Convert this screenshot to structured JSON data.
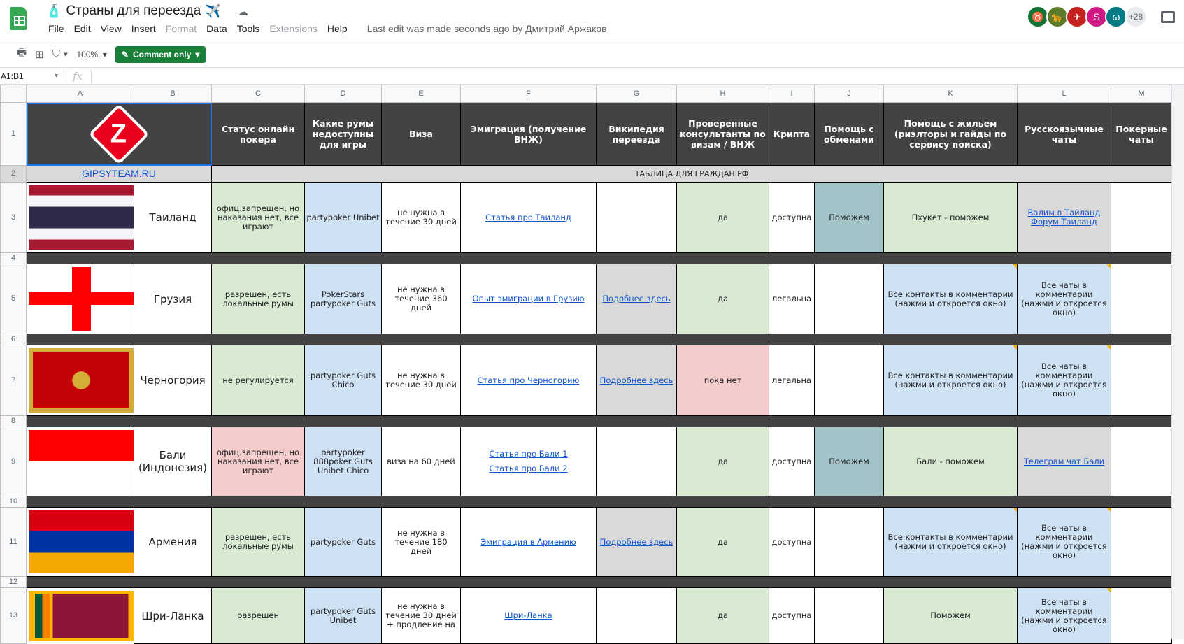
{
  "app": {
    "title": "Страны для переезда",
    "menu": [
      "File",
      "Edit",
      "View",
      "Insert",
      "Format",
      "Data",
      "Tools",
      "Extensions",
      "Help"
    ],
    "disabled_menu": [
      "Format",
      "Extensions"
    ],
    "last_edit": "Last edit was made seconds ago by Дмитрий Аржаков",
    "avatars_more": "+28"
  },
  "toolbar": {
    "zoom": "100%",
    "comment_only": "Comment only"
  },
  "formula": {
    "name_box": "A1:B1",
    "fx": "fx"
  },
  "columns": [
    "A",
    "B",
    "C",
    "D",
    "E",
    "F",
    "G",
    "H",
    "I",
    "J",
    "K",
    "L",
    "M"
  ],
  "row_numbers": [
    "1",
    "2",
    "3",
    "4",
    "5",
    "6",
    "7",
    "8",
    "9",
    "10",
    "11",
    "12",
    "13"
  ],
  "headers": [
    "Статус онлайн покера",
    "Какие румы недоступны для игры",
    "Виза",
    "Эмиграция (получение ВНЖ)",
    "Википедия переезда",
    "Проверенные консультанты по визам / ВНЖ",
    "Крипта",
    "Помощь с обменами",
    "Помощь с жильем (риэлторы и гайды по сервису поиска)",
    "Русскоязычные чаты",
    "Покерные чаты"
  ],
  "site_link": "GIPSYTEAM.RU",
  "logo_text": "Z",
  "banner": "ТАБЛИЦА ДЛЯ ГРАЖДАН РФ",
  "colors": {
    "green": "#d9ead3",
    "blue": "#cfe2f3",
    "gray": "#d9d9d9",
    "teal": "#a2c4c9",
    "pink": "#f4cccc",
    "white": "#ffffff",
    "dark": "#434343"
  },
  "rows": [
    {
      "flag": "thailand",
      "name": "Таиланд",
      "cells": [
        {
          "text": "офиц.запрещен, но наказания нет, все играют",
          "bg": "green"
        },
        {
          "text": "partypoker Unibet",
          "bg": "blue"
        },
        {
          "text": "не нужна в течение 30 дней",
          "bg": "white"
        },
        {
          "links": [
            "Статья про Таиланд"
          ],
          "bg": "white"
        },
        {
          "text": "",
          "bg": "white"
        },
        {
          "text": "да",
          "bg": "green"
        },
        {
          "text": "доступна",
          "bg": "white",
          "narrow": true
        },
        {
          "text": "Поможем",
          "bg": "teal"
        },
        {
          "text": "Пхукет - поможем",
          "bg": "green"
        },
        {
          "links": [
            "Валим в Тайланд",
            "Форум Таиланд"
          ],
          "bg": "gray"
        },
        {
          "text": "",
          "bg": "white"
        }
      ]
    },
    {
      "flag": "georgia",
      "name": "Грузия",
      "cells": [
        {
          "text": "разрешен, есть локальные румы",
          "bg": "green"
        },
        {
          "text": "PokerStars partypoker Guts",
          "bg": "blue"
        },
        {
          "text": "не нужна в течение 360 дней",
          "bg": "white"
        },
        {
          "links": [
            "Опыт эмиграции в Грузию"
          ],
          "bg": "white"
        },
        {
          "links": [
            "Подобнее здесь"
          ],
          "bg": "gray"
        },
        {
          "text": "да",
          "bg": "green"
        },
        {
          "text": "легальна",
          "bg": "white",
          "narrow": true
        },
        {
          "text": "",
          "bg": "white"
        },
        {
          "text": "Все контакты в комментарии (нажми и откроется окно)",
          "bg": "blue",
          "comment": true
        },
        {
          "text": "Все чаты в комментарии (нажми и откроется окно)",
          "bg": "blue",
          "comment": true
        },
        {
          "text": "",
          "bg": "white"
        }
      ]
    },
    {
      "flag": "montenegro",
      "name": "Черногория",
      "cells": [
        {
          "text": "не регулируется",
          "bg": "green"
        },
        {
          "text": "partypoker Guts Chico",
          "bg": "blue"
        },
        {
          "text": "не нужна в течение 30 дней",
          "bg": "white"
        },
        {
          "links": [
            "Статья про Черногорию"
          ],
          "bg": "white"
        },
        {
          "links": [
            "Подробнее здесь"
          ],
          "bg": "gray"
        },
        {
          "text": "пока нет",
          "bg": "pink"
        },
        {
          "text": "легальна",
          "bg": "white",
          "narrow": true
        },
        {
          "text": "",
          "bg": "white"
        },
        {
          "text": "Все контакты в комментарии (нажми и откроется окно)",
          "bg": "blue",
          "comment": true
        },
        {
          "text": "Все чаты в комментарии (нажми и откроется окно)",
          "bg": "blue",
          "comment": true
        },
        {
          "text": "",
          "bg": "white"
        }
      ]
    },
    {
      "flag": "indonesia",
      "name": "Бали (Индонезия)",
      "cells": [
        {
          "text": "офиц.запрещен, но наказания нет, все играют",
          "bg": "pink"
        },
        {
          "text": "partypoker 888poker Guts Unibet Chico",
          "bg": "blue"
        },
        {
          "text": "виза на 60 дней",
          "bg": "white"
        },
        {
          "links": [
            "Статья про Бали 1",
            "Статья про Бали 2"
          ],
          "bg": "white"
        },
        {
          "text": "",
          "bg": "white"
        },
        {
          "text": "да",
          "bg": "green"
        },
        {
          "text": "доступна",
          "bg": "white",
          "narrow": true
        },
        {
          "text": "Поможем",
          "bg": "teal"
        },
        {
          "text": "Бали - поможем",
          "bg": "green"
        },
        {
          "links": [
            "Телеграм чат Бали"
          ],
          "bg": "gray"
        },
        {
          "text": "",
          "bg": "white"
        }
      ]
    },
    {
      "flag": "armenia",
      "name": "Армения",
      "cells": [
        {
          "text": "разрешен, есть локальные румы",
          "bg": "green"
        },
        {
          "text": "partypoker Guts",
          "bg": "blue"
        },
        {
          "text": "не нужна в течение 180 дней",
          "bg": "white"
        },
        {
          "links": [
            "Эмиграция в Армению"
          ],
          "bg": "white"
        },
        {
          "links": [
            "Подробнее здесь"
          ],
          "bg": "gray"
        },
        {
          "text": "да",
          "bg": "green"
        },
        {
          "text": "доступна",
          "bg": "white",
          "narrow": true
        },
        {
          "text": "",
          "bg": "white"
        },
        {
          "text": "Все контакты в комментарии (нажми и откроется окно)",
          "bg": "blue",
          "comment": true
        },
        {
          "text": "Все чаты в комментарии (нажми и откроется окно)",
          "bg": "blue",
          "comment": true
        },
        {
          "text": "",
          "bg": "white"
        }
      ]
    },
    {
      "flag": "srilanka",
      "name": "Шри-Ланка",
      "cells": [
        {
          "text": "разрешен",
          "bg": "green"
        },
        {
          "text": "partypoker Guts Unibet",
          "bg": "blue"
        },
        {
          "text": "не нужна в течение 30 дней + продление на",
          "bg": "white"
        },
        {
          "links": [
            "Шри-Ланка"
          ],
          "bg": "white"
        },
        {
          "text": "",
          "bg": "white"
        },
        {
          "text": "да",
          "bg": "green"
        },
        {
          "text": "доступна",
          "bg": "white",
          "narrow": true
        },
        {
          "text": "",
          "bg": "white"
        },
        {
          "text": "Поможем",
          "bg": "green"
        },
        {
          "text": "Все чаты в комментарии (нажми и откроется окно)",
          "bg": "blue",
          "comment": true
        },
        {
          "text": "",
          "bg": "white"
        }
      ]
    }
  ]
}
